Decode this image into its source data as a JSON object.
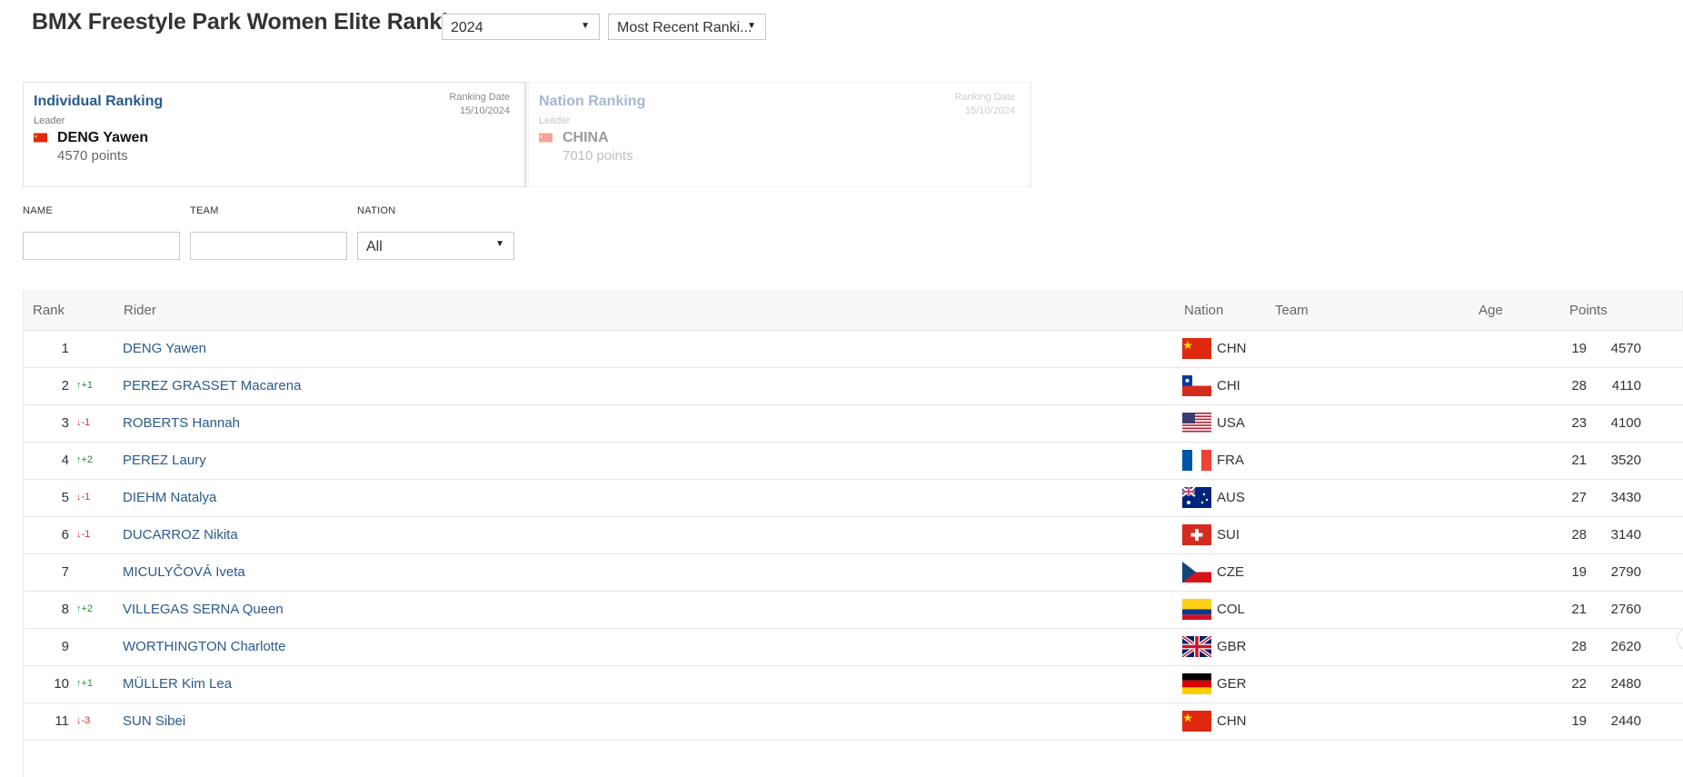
{
  "page": {
    "title": "BMX Freestyle Park Women Elite Ranking"
  },
  "controls": {
    "year": "2024",
    "ranking_type": "Most Recent Ranki..."
  },
  "individual_card": {
    "title": "Individual Ranking",
    "leader_label": "Leader",
    "date_label": "Ranking Date",
    "date": "15/10/2024",
    "leader_name": "DENG Yawen",
    "points": "4570 points"
  },
  "nation_card": {
    "title": "Nation Ranking",
    "leader_label": "Leader",
    "date_label": "Ranking Date",
    "date": "15/10/2024",
    "leader_name": "CHINA",
    "points": "7010 points"
  },
  "filters": {
    "name_label": "NAME",
    "team_label": "TEAM",
    "nation_label": "NATION",
    "name_value": "",
    "team_value": "",
    "nation_value": "All"
  },
  "table": {
    "headers": {
      "rank": "Rank",
      "rider": "Rider",
      "nation": "Nation",
      "team": "Team",
      "age": "Age",
      "points": "Points"
    },
    "rows": [
      {
        "rank": "1",
        "change": "",
        "dir": "",
        "rider": "DENG Yawen",
        "nation": "CHN",
        "team": "",
        "age": "19",
        "points": "4570"
      },
      {
        "rank": "2",
        "change": "+1",
        "dir": "up",
        "rider": "PEREZ GRASSET Macarena",
        "nation": "CHI",
        "team": "",
        "age": "28",
        "points": "4110"
      },
      {
        "rank": "3",
        "change": "-1",
        "dir": "down",
        "rider": "ROBERTS Hannah",
        "nation": "USA",
        "team": "",
        "age": "23",
        "points": "4100"
      },
      {
        "rank": "4",
        "change": "+2",
        "dir": "up",
        "rider": "PEREZ Laury",
        "nation": "FRA",
        "team": "",
        "age": "21",
        "points": "3520"
      },
      {
        "rank": "5",
        "change": "-1",
        "dir": "down",
        "rider": "DIEHM Natalya",
        "nation": "AUS",
        "team": "",
        "age": "27",
        "points": "3430"
      },
      {
        "rank": "6",
        "change": "-1",
        "dir": "down",
        "rider": "DUCARROZ Nikita",
        "nation": "SUI",
        "team": "",
        "age": "28",
        "points": "3140"
      },
      {
        "rank": "7",
        "change": "",
        "dir": "",
        "rider": "MICULYČOVÁ Iveta",
        "nation": "CZE",
        "team": "",
        "age": "19",
        "points": "2790"
      },
      {
        "rank": "8",
        "change": "+2",
        "dir": "up",
        "rider": "VILLEGAS SERNA Queen",
        "nation": "COL",
        "team": "",
        "age": "21",
        "points": "2760"
      },
      {
        "rank": "9",
        "change": "",
        "dir": "",
        "rider": "WORTHINGTON Charlotte",
        "nation": "GBR",
        "team": "",
        "age": "28",
        "points": "2620"
      },
      {
        "rank": "10",
        "change": "+1",
        "dir": "up",
        "rider": "MÜLLER Kim Lea",
        "nation": "GER",
        "team": "",
        "age": "22",
        "points": "2480"
      },
      {
        "rank": "11",
        "change": "-3",
        "dir": "down",
        "rider": "SUN Sibei",
        "nation": "CHN",
        "team": "",
        "age": "19",
        "points": "2440"
      }
    ]
  },
  "colors": {
    "link": "#2a5a8c",
    "up": "#2e8b3a",
    "down": "#d0342c"
  }
}
